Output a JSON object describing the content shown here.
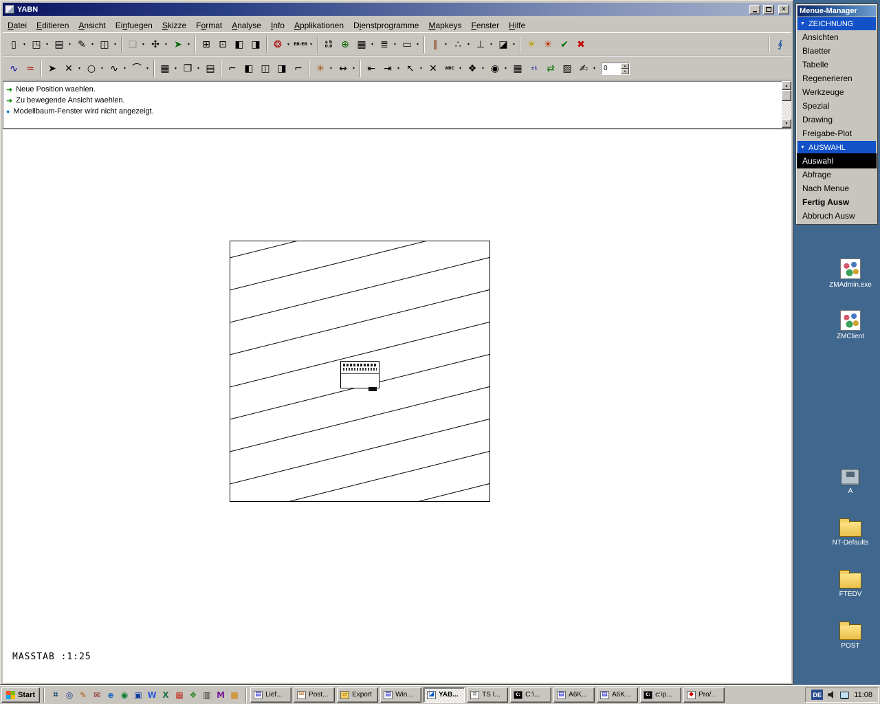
{
  "colors": {
    "desktop": "#40678e",
    "window_gray": "#c8c5be",
    "title_gradient_start": "#0b1563",
    "title_gradient_end": "#a6b2cc",
    "header_blue": "#1251c8",
    "selection_black": "#000000",
    "message_green": "#008000",
    "message_blue": "#0080c0"
  },
  "window": {
    "title": "YABN"
  },
  "menubar": {
    "items": [
      {
        "label": "Datei",
        "accel": 0
      },
      {
        "label": "Editieren",
        "accel": 0
      },
      {
        "label": "Ansicht",
        "accel": 0
      },
      {
        "label": "Einfuegen",
        "accel": 2
      },
      {
        "label": "Skizze",
        "accel": 0
      },
      {
        "label": "Format",
        "accel": 1
      },
      {
        "label": "Analyse",
        "accel": 0
      },
      {
        "label": "Info",
        "accel": 0
      },
      {
        "label": "Applikationen",
        "accel": 0
      },
      {
        "label": "Dienstprogramme",
        "accel": 1
      },
      {
        "label": "Mapkeys",
        "accel": 0
      },
      {
        "label": "Fenster",
        "accel": 0
      },
      {
        "label": "Hilfe",
        "accel": 0
      }
    ]
  },
  "toolbar1": [
    {
      "n": "new-file-button",
      "g": "▯",
      "d": 1
    },
    {
      "n": "open-file-button",
      "g": "◳",
      "d": 1
    },
    {
      "n": "print-button",
      "g": "▤",
      "d": 1
    },
    {
      "n": "modify-button",
      "g": "✎",
      "d": 1
    },
    {
      "n": "save-button",
      "g": "◫",
      "d": 1
    },
    {
      "n": "component-button",
      "g": "❑",
      "d": 1,
      "sep": 1,
      "gray": 1
    },
    {
      "n": "model-relations-button",
      "g": "✣",
      "d": 1
    },
    {
      "n": "regenerate-run-button",
      "g": "➤",
      "d": 1,
      "c": "#006600"
    },
    {
      "n": "sheet-window-button",
      "g": "⊞",
      "sep": 1
    },
    {
      "n": "sheet-lock-button",
      "g": "⊡"
    },
    {
      "n": "sheet-split-button",
      "g": "◧"
    },
    {
      "n": "sheet-pane-button",
      "g": "◨"
    },
    {
      "n": "color-wheel-button",
      "g": "❂",
      "d": 1,
      "sep": 1,
      "c": "#aa0000"
    },
    {
      "n": "eb-eb-button",
      "t": "EB-EB",
      "d": 1
    },
    {
      "n": "decimal-digits-button",
      "t": "a b\n0.0",
      "sep": 1
    },
    {
      "n": "globe-button",
      "g": "⊕",
      "c": "#006600"
    },
    {
      "n": "layer-grid-button",
      "g": "▦",
      "d": 1
    },
    {
      "n": "layers-button",
      "g": "≣",
      "d": 1
    },
    {
      "n": "display-window-button",
      "g": "▭",
      "d": 1
    },
    {
      "n": "datum-axes-button",
      "g": "∥",
      "d": 1,
      "sep": 1,
      "c": "#803000"
    },
    {
      "n": "datum-points-button",
      "g": "∴",
      "d": 1
    },
    {
      "n": "datum-csys-button",
      "g": "⊥",
      "d": 1
    },
    {
      "n": "datum-planes-button",
      "g": "◪",
      "d": 1
    },
    {
      "n": "spotlight-button",
      "g": "☀",
      "sep": 1,
      "c": "#b8a000"
    },
    {
      "n": "render-light-button",
      "g": "☀",
      "c": "#c03000"
    },
    {
      "n": "confirm-button",
      "g": "✔",
      "c": "#007000"
    },
    {
      "n": "abort-button",
      "g": "✖",
      "c": "#c00000"
    },
    {
      "gap": 1
    },
    {
      "n": "attach-paperclip-button",
      "g": "∮",
      "sep": 1,
      "c": "#0040a0"
    }
  ],
  "toolbar2": [
    {
      "n": "verify-curvature-button",
      "g": "∿",
      "c": "#0000aa"
    },
    {
      "n": "verify-deviation-button",
      "g": "≈",
      "c": "#aa0000"
    },
    {
      "n": "select-arrow-button",
      "g": "➤",
      "sep": 1
    },
    {
      "n": "erase-button",
      "g": "✕",
      "d": 1
    },
    {
      "n": "circle-tool-button",
      "g": "○",
      "d": 1
    },
    {
      "n": "spline-tool-button",
      "g": "∿",
      "d": 1
    },
    {
      "n": "arc-tool-button",
      "g": "⌒",
      "d": 1
    },
    {
      "n": "grid-button",
      "g": "▦",
      "d": 1,
      "sep": 1
    },
    {
      "n": "copy-button",
      "g": "❐",
      "d": 1
    },
    {
      "n": "fill-table-button",
      "g": "▤"
    },
    {
      "n": "corner-view-button",
      "g": "⌐",
      "sep": 1
    },
    {
      "n": "sheet-shift-left-button",
      "g": "◧"
    },
    {
      "n": "sheet-shift-both-button",
      "g": "◫"
    },
    {
      "n": "sheet-shift-right-button",
      "g": "◨"
    },
    {
      "n": "corner-view-2-button",
      "g": "⌐"
    },
    {
      "n": "snap-line-button",
      "g": "✳",
      "d": 1,
      "sep": 1,
      "c": "#a05000"
    },
    {
      "n": "dimension-button",
      "g": "↔",
      "d": 1
    },
    {
      "n": "move-left-button",
      "g": "⇤",
      "sep": 1
    },
    {
      "n": "move-right-button",
      "g": "⇥",
      "d": 1
    },
    {
      "n": "move-corner-button",
      "g": "↖",
      "d": 1
    },
    {
      "n": "remove-button",
      "g": "✕"
    },
    {
      "n": "text-note-button",
      "t": "ABC",
      "d": 1
    },
    {
      "n": "symbol-button",
      "g": "❖",
      "d": 1
    },
    {
      "n": "balloon-button",
      "g": "◉",
      "d": 1
    },
    {
      "n": "table-cells-button",
      "g": "▦"
    },
    {
      "n": "tolerance-button",
      "t": "±1",
      "c": "#0000aa"
    },
    {
      "n": "update-swap-button",
      "g": "⇄",
      "c": "#007000"
    },
    {
      "n": "hatch-button",
      "g": "▨"
    },
    {
      "n": "annotate-button",
      "g": "✍",
      "d": 1
    },
    {
      "n": "scale-spinner",
      "type": "spin",
      "value": "0"
    }
  ],
  "messages": [
    {
      "icon": "arrow",
      "text": "Neue Position waehlen."
    },
    {
      "icon": "arrow",
      "text": "Zu bewegende Ansicht waehlen."
    },
    {
      "icon": "dot",
      "text": "Modellbaum-Fenster wird nicht angezeigt."
    }
  ],
  "canvas": {
    "scale_text": "MASSTAB :1:25"
  },
  "menue_manager": {
    "title": "Menue-Manager",
    "sections": [
      {
        "header": "ZEICHNUNG",
        "items": [
          {
            "label": "Ansichten"
          },
          {
            "label": "Blaetter"
          },
          {
            "label": "Tabelle"
          },
          {
            "label": "Regenerieren"
          },
          {
            "label": "Werkzeuge"
          },
          {
            "label": "Spezial"
          },
          {
            "label": "Drawing"
          },
          {
            "label": "Freigabe-Plot"
          }
        ]
      },
      {
        "header": "AUSWAHL",
        "items": [
          {
            "label": "Auswahl",
            "selected": true
          },
          {
            "label": "Abfrage"
          },
          {
            "label": "Nach Menue"
          },
          {
            "label": "Fertig Ausw",
            "bold": true
          },
          {
            "label": "Abbruch Ausw"
          }
        ]
      }
    ]
  },
  "desktop": {
    "icons": [
      {
        "name": "zmadmin",
        "label": "ZMAdmin.exe",
        "kind": "app"
      },
      {
        "name": "zmclient",
        "label": "ZMClient",
        "kind": "app"
      },
      {
        "name": "drive-a",
        "label": "A",
        "kind": "drive"
      },
      {
        "name": "nt-defaults",
        "label": "NT-Defaults",
        "kind": "folder"
      },
      {
        "name": "ftedv",
        "label": "FTEDV",
        "kind": "folder"
      },
      {
        "name": "post",
        "label": "POST",
        "kind": "folder"
      }
    ]
  },
  "taskbar": {
    "start_label": "Start",
    "quick_launch": [
      {
        "name": "show-desktop-icon",
        "glyph": "⌗",
        "color": "#1a4f7a"
      },
      {
        "name": "search-icon",
        "glyph": "◎",
        "color": "#123a8a"
      },
      {
        "name": "notes-icon",
        "glyph": "✎",
        "color": "#b05a10"
      },
      {
        "name": "mail-icon",
        "glyph": "✉",
        "color": "#8a2020"
      },
      {
        "name": "internet-explorer-icon",
        "glyph": "e",
        "color": "#1569c7"
      },
      {
        "name": "netscape-icon",
        "glyph": "◉",
        "color": "#0a7a30"
      },
      {
        "name": "monitor-icon",
        "glyph": "▣",
        "color": "#1040a0"
      },
      {
        "name": "word-icon",
        "glyph": "W",
        "color": "#2a5bd7"
      },
      {
        "name": "excel-icon",
        "glyph": "X",
        "color": "#1e7145"
      },
      {
        "name": "grid-app-icon",
        "glyph": "▦",
        "color": "#c03020"
      },
      {
        "name": "green-app-icon",
        "glyph": "❖",
        "color": "#2a8a2a"
      },
      {
        "name": "terminal-icon",
        "glyph": "▥",
        "color": "#333333"
      },
      {
        "name": "media-app-icon",
        "glyph": "M",
        "color": "#7a1a9a"
      },
      {
        "name": "palette-app-icon",
        "glyph": "▩",
        "color": "#d08000"
      }
    ],
    "tasks": [
      {
        "label": "Lief...",
        "icon": "document-icon",
        "glyph": "▤",
        "fg": "#0000cc",
        "bg": "#ffffff"
      },
      {
        "label": "Post...",
        "icon": "mail-icon",
        "glyph": "✉",
        "fg": "#b06000",
        "bg": "#ffffff"
      },
      {
        "label": "Export",
        "icon": "folder-icon",
        "glyph": "▱",
        "fg": "#7a5b00",
        "bg": "#f4d060"
      },
      {
        "label": "Win...",
        "icon": "document-icon",
        "glyph": "▤",
        "fg": "#0000cc",
        "bg": "#ffffff"
      },
      {
        "label": "YAB...",
        "icon": "drawing-icon",
        "glyph": "◪",
        "fg": "#0055cc",
        "bg": "#ffffff",
        "active": true
      },
      {
        "label": "TS I...",
        "icon": "notepad-icon",
        "glyph": "≡",
        "fg": "#555555",
        "bg": "#ffffff"
      },
      {
        "label": "C:\\...",
        "icon": "console-icon",
        "glyph": "C:",
        "fg": "#ffffff",
        "bg": "#000000"
      },
      {
        "label": "A6K...",
        "icon": "document-icon",
        "glyph": "▤",
        "fg": "#0000cc",
        "bg": "#ffffff"
      },
      {
        "label": "A6K...",
        "icon": "document-icon",
        "glyph": "▤",
        "fg": "#0000cc",
        "bg": "#ffffff"
      },
      {
        "label": "c:\\p...",
        "icon": "console-icon",
        "glyph": "C:",
        "fg": "#ffffff",
        "bg": "#000000"
      },
      {
        "label": "Pro/...",
        "icon": "app-icon",
        "glyph": "◆",
        "fg": "#cc0000",
        "bg": "#ffffff"
      }
    ],
    "tray": {
      "language": "DE",
      "time": "11:08"
    }
  }
}
